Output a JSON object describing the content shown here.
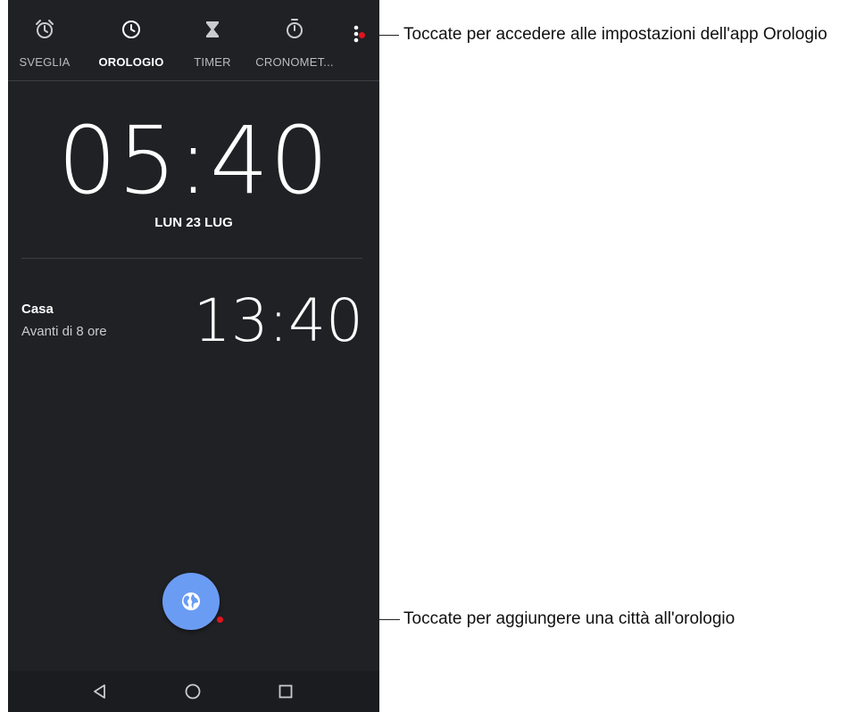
{
  "tabs": [
    {
      "label": "SVEGLIA",
      "icon": "alarm-icon",
      "active": false
    },
    {
      "label": "OROLOGIO",
      "icon": "clock-icon",
      "active": true
    },
    {
      "label": "TIMER",
      "icon": "hourglass-icon",
      "active": false
    },
    {
      "label": "CRONOMET...",
      "icon": "stopwatch-icon",
      "active": false
    }
  ],
  "main": {
    "time": "05:40",
    "date": "LUN 23 LUG"
  },
  "cities": [
    {
      "name": "Casa",
      "offset": "Avanti di 8 ore",
      "time": "13:40"
    }
  ],
  "fab": {
    "icon": "globe-icon"
  },
  "navbar": {
    "icons": [
      "back-icon",
      "home-icon",
      "recents-icon"
    ]
  },
  "callouts": {
    "settings": "Toccate per accedere alle impostazioni dell'app Orologio",
    "add_city": "Toccate per aggiungere una città all'orologio"
  },
  "colors": {
    "background": "#202125",
    "fab": "#6b9cf3",
    "callout_dot": "#e0141e"
  }
}
